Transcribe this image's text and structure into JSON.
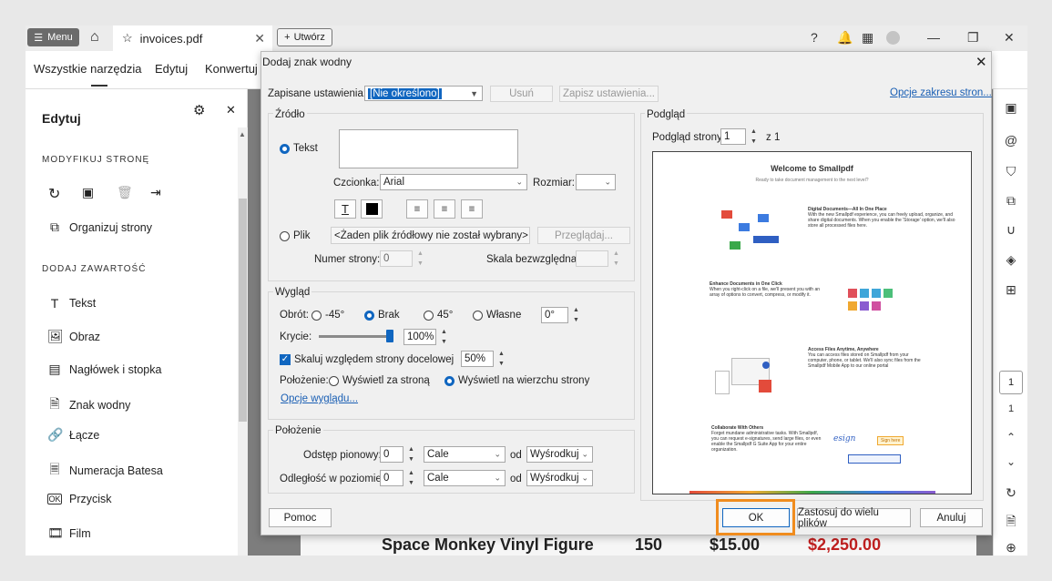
{
  "titlebar": {
    "menu_label": "Menu",
    "tab_title": "invoices.pdf",
    "create_label": "Utwórz"
  },
  "toolbar": {
    "tabs": [
      "Wszystkie narzędzia",
      "Edytuj",
      "Konwertuj"
    ]
  },
  "left_panel": {
    "title": "Edytuj",
    "section_modify": "MODYFIKUJ STRONĘ",
    "organize_label": "Organizuj strony",
    "section_add": "DODAJ ZAWARTOŚĆ",
    "items": [
      "Tekst",
      "Obraz",
      "Nagłówek i stopka",
      "Znak wodny",
      "Łącze",
      "Numeracja Batesa",
      "Przycisk",
      "Film"
    ]
  },
  "document": {
    "row_text": "Space Monkey Vinyl Figure",
    "qty": "150",
    "price": "$15.00",
    "total": "$2,250.00"
  },
  "right_rail": {
    "page_box": "1",
    "page_total": "1"
  },
  "dialog": {
    "title": "Dodaj znak wodny",
    "saved_settings_label": "Zapisane ustawienia:",
    "saved_settings_value": "[Nie określono]",
    "delete_btn": "Usuń",
    "save_settings_btn": "Zapisz ustawienia...",
    "range_options_link": "Opcje zakresu stron...",
    "source": {
      "title": "Źródło",
      "text_radio": "Tekst",
      "font_label": "Czcionka:",
      "font_value": "Arial",
      "size_label": "Rozmiar:",
      "file_radio": "Plik",
      "file_value": "<Żaden plik źródłowy nie został wybrany>",
      "browse_btn": "Przeglądaj...",
      "page_number_label": "Numer strony:",
      "page_number_value": "0",
      "absolute_scale_label": "Skala bezwzględna:"
    },
    "appearance": {
      "title": "Wygląd",
      "rotation_label": "Obrót:",
      "rot_m45": "-45°",
      "rot_none": "Brak",
      "rot_45": "45°",
      "rot_custom": "Własne",
      "rot_value": "0°",
      "opacity_label": "Krycie:",
      "opacity_value": "100%",
      "opacity_level": 1.0,
      "scale_check_label": "Skaluj względem strony docelowej",
      "scale_value": "50%",
      "position_label": "Położenie:",
      "behind_label": "Wyświetl za stroną",
      "front_label": "Wyświetl na wierzchu strony",
      "appearance_options_link": "Opcje wyglądu..."
    },
    "position": {
      "title": "Położenie",
      "vertical_label": "Odstęp pionowy:",
      "vertical_value": "0",
      "vertical_unit": "Cale",
      "from_label": "od",
      "vertical_anchor": "Wyśrodkuj",
      "horizontal_label": "Odległość w poziomie:",
      "horizontal_value": "0",
      "horizontal_unit": "Cale",
      "horizontal_anchor": "Wyśrodkuj"
    },
    "preview": {
      "title": "Podgląd",
      "page_label": "Podgląd strony",
      "page_value": "1",
      "of_label": "z 1",
      "doc_title": "Welcome to Smallpdf",
      "doc_subtitle": "Ready to take document management to the next level?",
      "sec1_title": "Digital Documents—All In One Place",
      "sec1_body": "With the new Smallpdf experience, you can freely upload, organize, and share digital documents. When you enable the 'Storage' option, we'll also store all processed files here.",
      "sec2_title": "Enhance Documents in One Click",
      "sec2_body": "When you right-click on a file, we'll present you with an array of options to convert, compress, or modify it.",
      "sec3_title": "Access Files Anytime, Anywhere",
      "sec3_body": "You can access files stored on Smallpdf from your computer, phone, or tablet. We'll also sync files from the Smallpdf Mobile App to our online portal",
      "sec4_title": "Collaborate With Others",
      "sec4_body": "Forget mundane administrative tasks. With Smallpdf, you can request e-signatures, send large files, or even enable the Smallpdf G Suite App for your entire organization.",
      "sign_here": "Sign here"
    },
    "help_btn": "Pomoc",
    "ok_btn": "OK",
    "apply_multiple_btn": "Zastosuj do wielu plików",
    "cancel_btn": "Anuluj"
  }
}
